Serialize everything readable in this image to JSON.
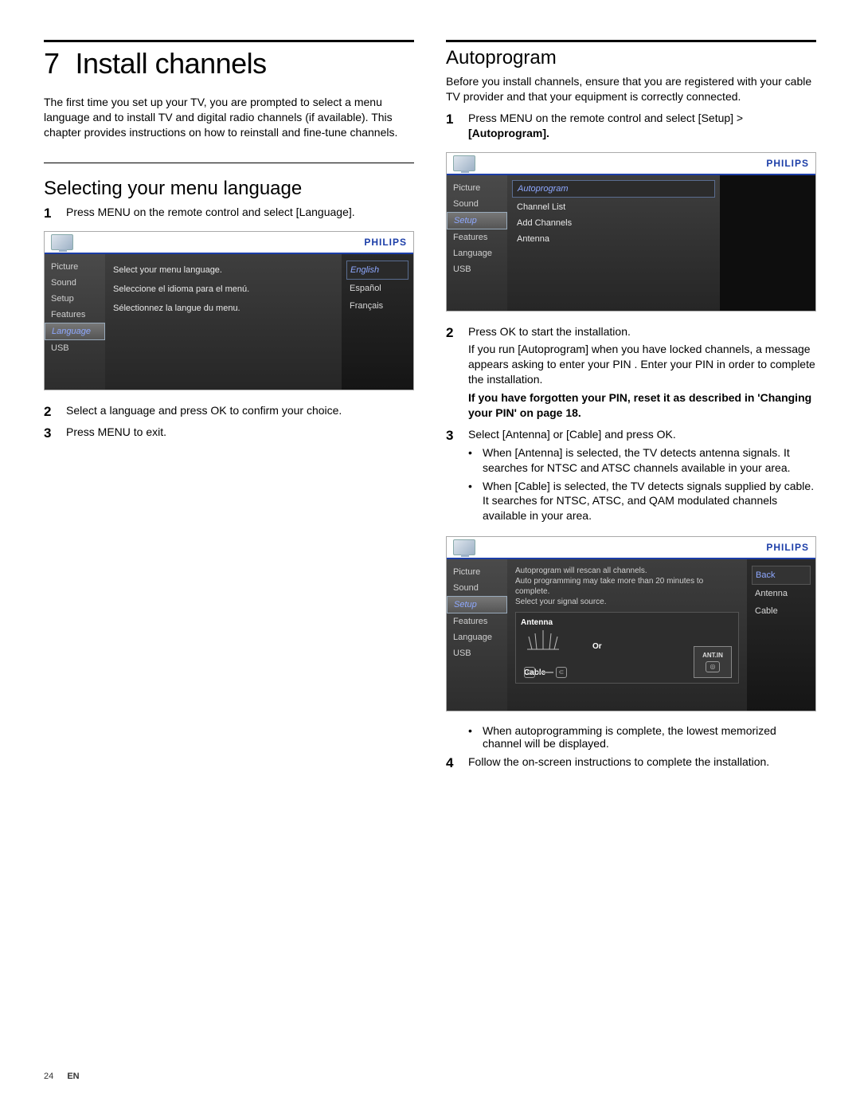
{
  "chapter": {
    "number": "7",
    "title": "Install channels"
  },
  "intro": "The first time you set up your TV, you are prompted to select a menu language and to install TV and digital radio channels (if available). This chapter provides instructions on how to reinstall and fine-tune channels.",
  "leftSection": {
    "title": "Selecting your menu language",
    "steps": {
      "s1": "Press MENU on the remote control and select [Language].",
      "s2": "Select a language and press OK to confirm your choice.",
      "s3": "Press MENU to exit."
    }
  },
  "rightSection": {
    "title": "Autoprogram",
    "intro": "Before you install channels, ensure that you are registered with your cable TV provider and that your equipment is correctly connected.",
    "steps": {
      "s1a": "Press MENU on the remote control and select [Setup] > ",
      "s1b": "[Autoprogram].",
      "s2a": "Press OK to start the installation.",
      "s2b": "If you run [Autoprogram] when you have locked channels, a message appears asking to enter your PIN . Enter your PIN in order to complete the installation.",
      "s2c": "If you have forgotten your PIN, reset it as described in 'Changing your PIN' on page 18.",
      "s3a": "Select [Antenna] or [Cable] and press OK.",
      "s3_b1": "When [Antenna] is selected, the TV detects antenna signals. It searches for NTSC and ATSC channels available in your area.",
      "s3_b2": "When [Cable] is selected, the TV detects signals supplied by cable. It searches for NTSC, ATSC, and QAM modulated channels available in your area.",
      "s3_after": "When autoprogramming is complete, the lowest memorized channel will be displayed.",
      "s4": "Follow the on-screen instructions to complete the installation."
    }
  },
  "brand": "PHILIPS",
  "tvNav": [
    "Picture",
    "Sound",
    "Setup",
    "Features",
    "Language",
    "USB"
  ],
  "ss1": {
    "mid": [
      "Select your menu language.",
      "Seleccione el idioma para el menú.",
      "Sélectionnez la langue du menu."
    ],
    "right": [
      "English",
      "Español",
      "Français"
    ]
  },
  "ss2": {
    "mid": [
      "Autoprogram",
      "Channel List",
      "Add Channels",
      "Antenna"
    ]
  },
  "ss3": {
    "info1": "Autoprogram will rescan all channels.",
    "info2": "Auto programming  may take more than 20 minutes to complete.",
    "info3": "Select your signal source.",
    "antenna": "Antenna",
    "cable": "Cable",
    "or": "Or",
    "antin": "ANT.IN",
    "right": [
      "Back",
      "Antenna",
      "Cable"
    ]
  },
  "footer": {
    "page": "24",
    "lang": "EN"
  }
}
